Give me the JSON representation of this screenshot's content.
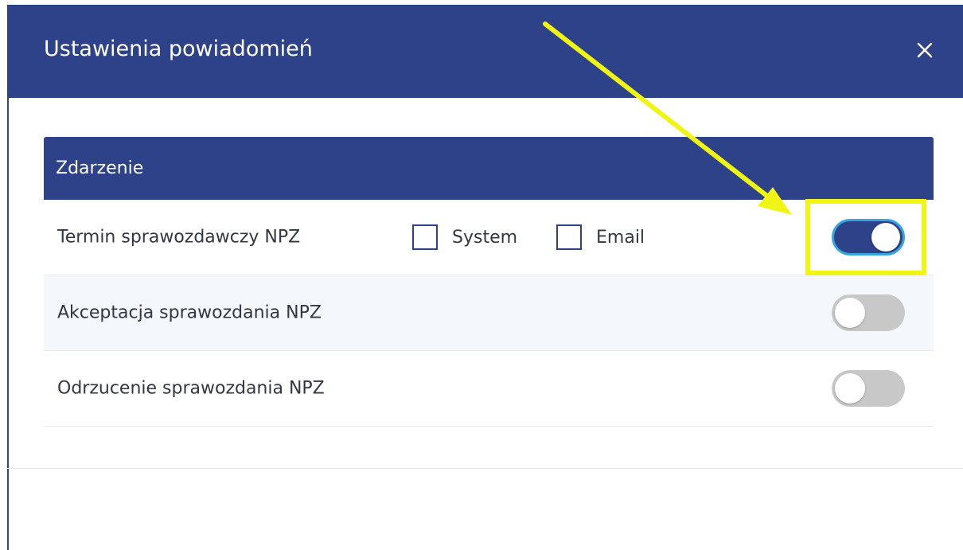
{
  "dialog": {
    "title": "Ustawienia powiadomień",
    "close_icon": "close-icon"
  },
  "table": {
    "header": "Zdarzenie",
    "rows": [
      {
        "label": "Termin sprawozdawczy NPZ",
        "checkboxes": [
          {
            "label": "System",
            "checked": false
          },
          {
            "label": "Email",
            "checked": false
          }
        ],
        "enabled": true
      },
      {
        "label": "Akceptacja sprawozdania NPZ",
        "enabled": false
      },
      {
        "label": "Odrzucenie sprawozdania NPZ",
        "enabled": false
      }
    ]
  },
  "annotation": {
    "color": "#f0f514",
    "type": "arrow-and-highlight"
  },
  "colors": {
    "header_bg": "#2e4289",
    "toggle_on": "#2e4289",
    "toggle_off": "#c8c8c8",
    "row_alt": "#f4f8fd"
  }
}
